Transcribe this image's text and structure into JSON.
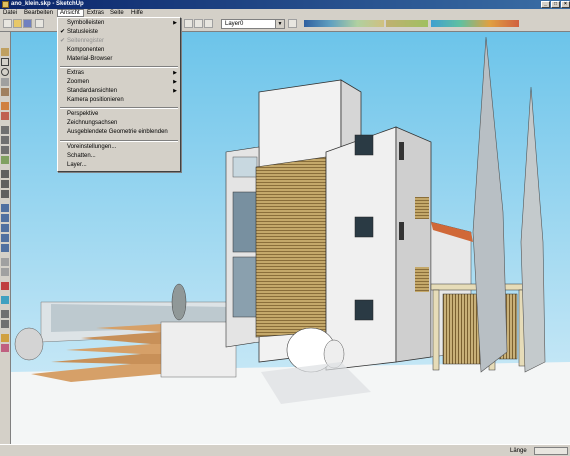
{
  "window": {
    "title": "ano_klein.skp - SketchUp"
  },
  "menubar": {
    "items": [
      {
        "label": "Datei"
      },
      {
        "label": "Bearbeiten"
      },
      {
        "label": "Ansicht"
      },
      {
        "label": "Extras"
      },
      {
        "label": "Seite"
      },
      {
        "label": "Hilfe"
      }
    ]
  },
  "toolbar": {
    "layer_value": "Layer0"
  },
  "view_menu": {
    "items": [
      {
        "label": "Symbolleisten",
        "checked": false,
        "submenu": true,
        "disabled": false
      },
      {
        "label": "Statusleiste",
        "checked": true,
        "submenu": false,
        "disabled": false
      },
      {
        "label": "Seitenregister",
        "checked": true,
        "submenu": false,
        "disabled": true
      },
      {
        "label": "Komponenten",
        "checked": false,
        "submenu": false,
        "disabled": false
      },
      {
        "label": "Material-Browser",
        "checked": false,
        "submenu": false,
        "disabled": false
      },
      {
        "label": "Extras",
        "checked": false,
        "submenu": true,
        "disabled": false
      },
      {
        "label": "Zoomen",
        "checked": false,
        "submenu": true,
        "disabled": false
      },
      {
        "label": "Standardansichten",
        "checked": false,
        "submenu": true,
        "disabled": false
      },
      {
        "label": "Kamera positionieren",
        "checked": false,
        "submenu": false,
        "disabled": false
      },
      {
        "label": "Perspektive",
        "checked": false,
        "submenu": false,
        "disabled": false
      },
      {
        "label": "Zeichnungsachsen",
        "checked": false,
        "submenu": false,
        "disabled": false
      },
      {
        "label": "Ausgeblendete Geometrie einblenden",
        "checked": false,
        "submenu": false,
        "disabled": false
      },
      {
        "label": "Voreinstellungen...",
        "checked": false,
        "submenu": false,
        "disabled": false
      },
      {
        "label": "Schatten...",
        "checked": false,
        "submenu": false,
        "disabled": false
      },
      {
        "label": "Layer...",
        "checked": false,
        "submenu": false,
        "disabled": false
      }
    ],
    "check_glyph": "✔",
    "submenu_glyph": "▶"
  },
  "statusbar": {
    "field_label": "Länge"
  },
  "colors": {
    "sky": "#9fd6ee",
    "title_bar": "#0a246a",
    "wood": "#b89a5a"
  }
}
